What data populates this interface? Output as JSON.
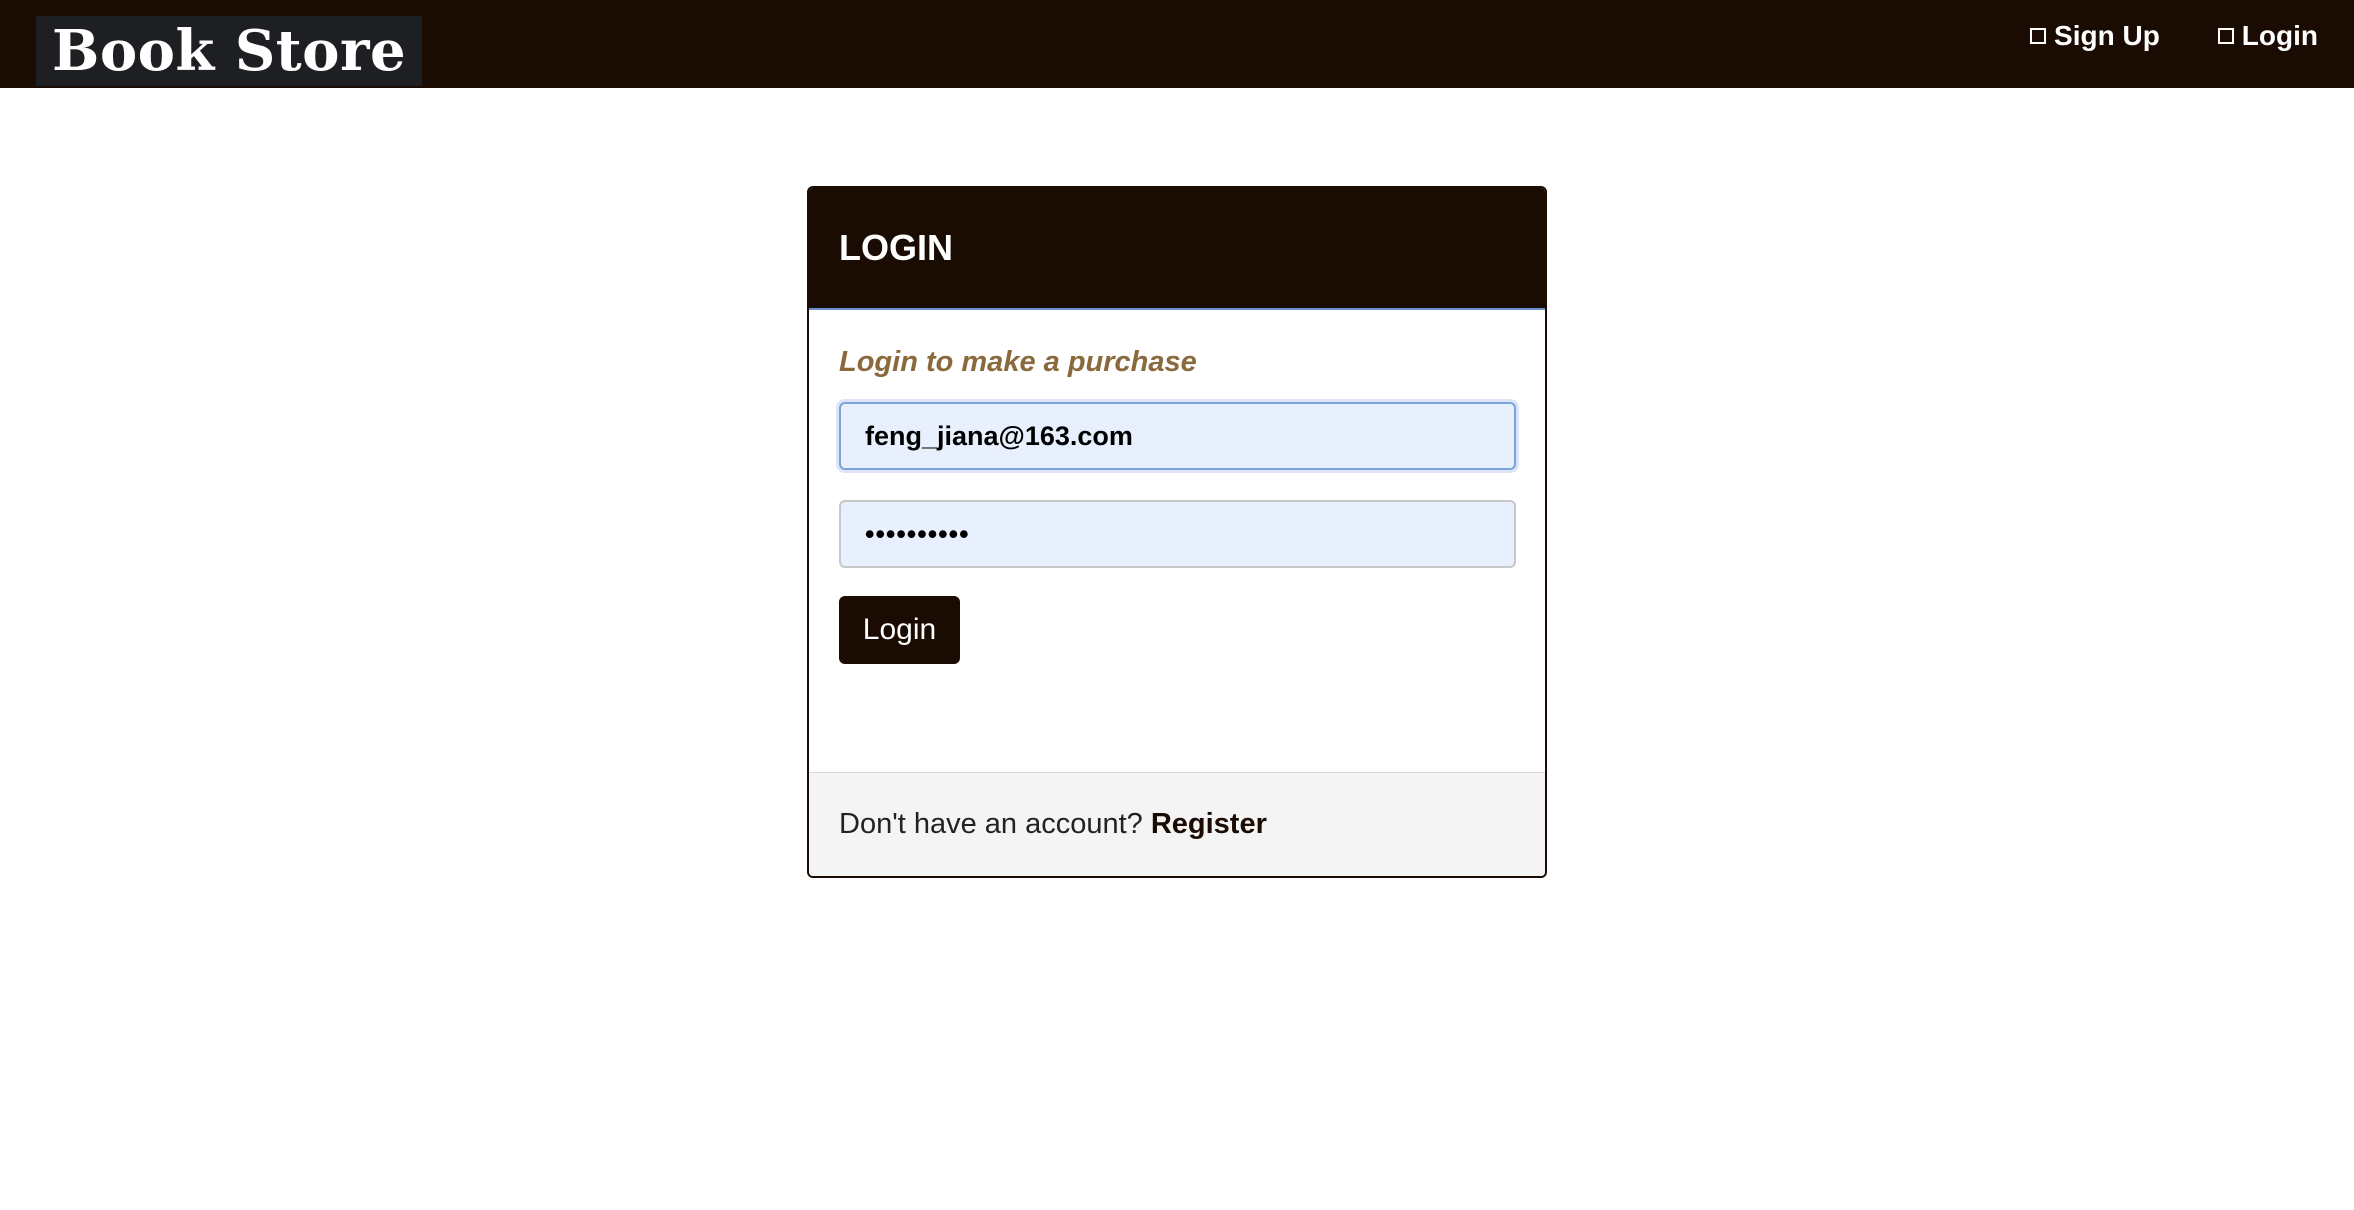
{
  "navbar": {
    "brand": "Book Store",
    "links": [
      {
        "label": "Sign Up",
        "icon": "signup-icon"
      },
      {
        "label": "Login",
        "icon": "login-icon"
      }
    ]
  },
  "login_card": {
    "title": "LOGIN",
    "subtitle": "Login to make a purchase",
    "email_value": "feng_jiana@163.com",
    "password_value": "••••••••••",
    "submit_label": "Login",
    "footer_text": "Don't have an account?",
    "register_label": "Register"
  },
  "colors": {
    "navbar_bg": "#1a0c03",
    "subtitle": "#8a6a3c",
    "input_bg": "#e8f0fd",
    "footer_bg": "#f4f4f4"
  }
}
